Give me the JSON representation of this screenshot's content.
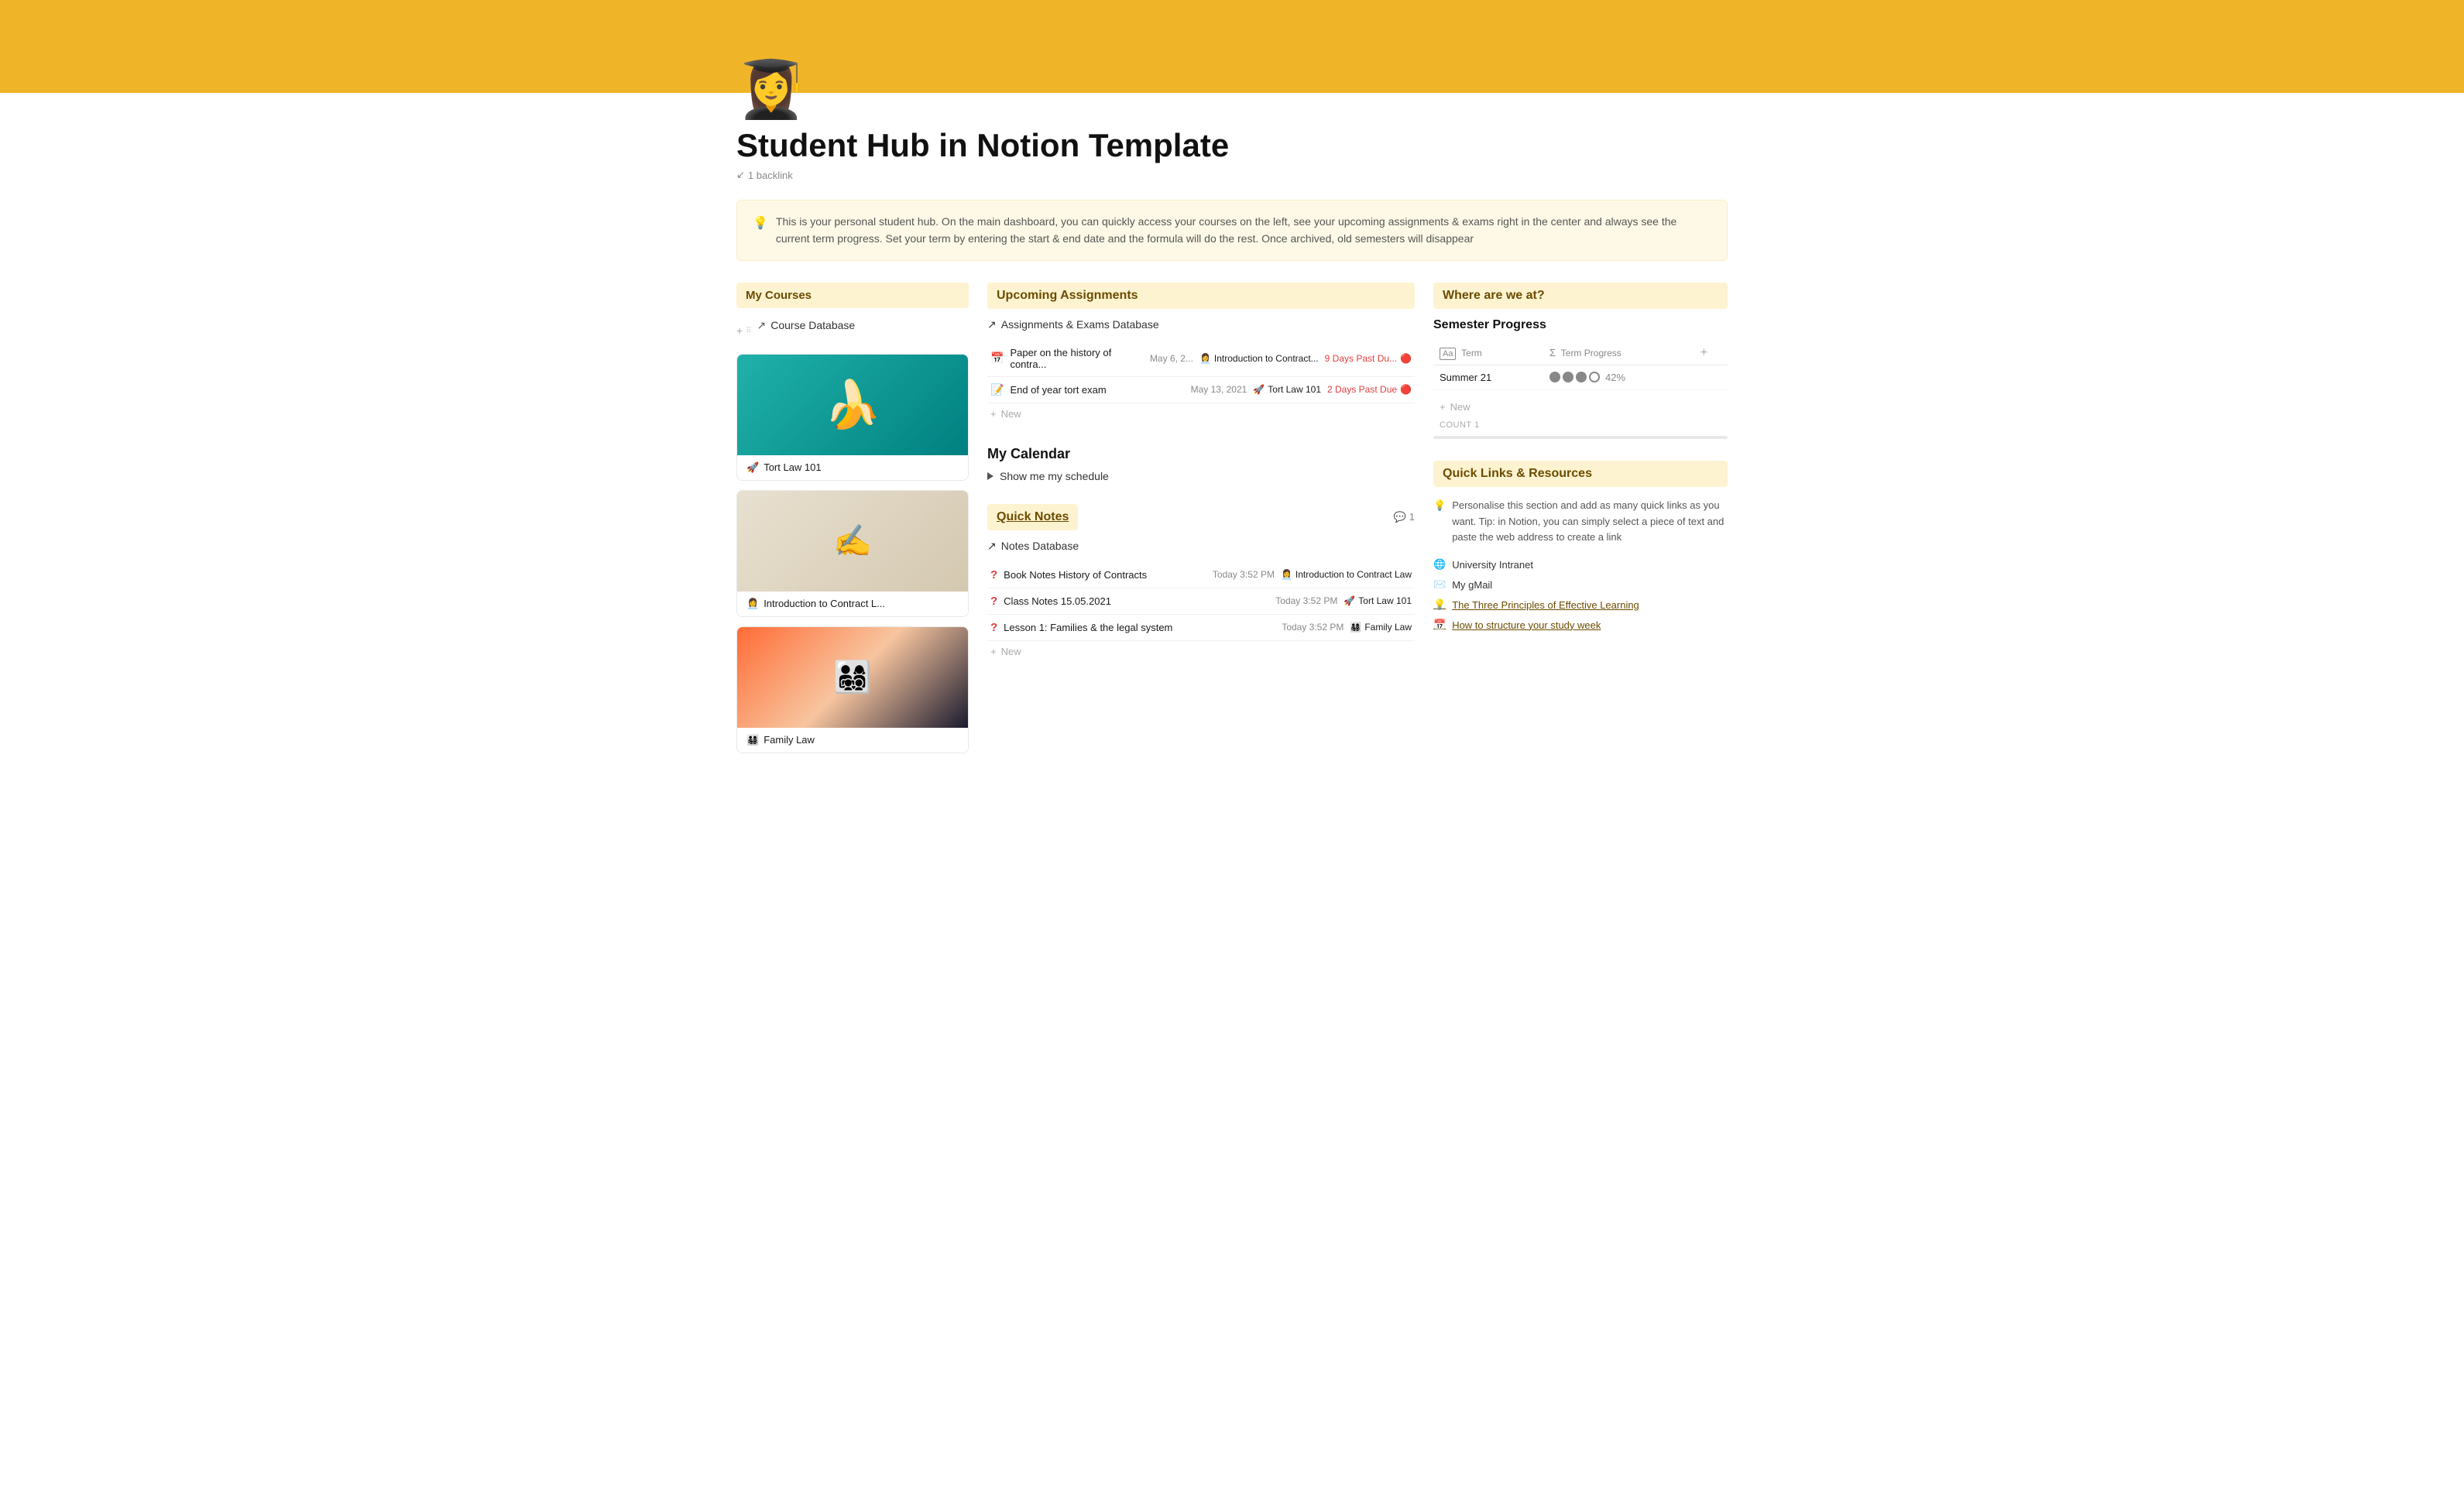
{
  "page": {
    "banner_color": "#f0b429",
    "icon": "👩‍🎓",
    "title": "Student Hub in Notion Template",
    "backlink_count": "1 backlink",
    "info_text": "This is your personal student hub. On the main dashboard, you can quickly access your courses on the left, see your upcoming assignments & exams right in the center and always see the current term progress. Set your term by entering the start & end date and the formula will do the rest. Once archived, old semesters will disappear"
  },
  "my_courses": {
    "title": "My Courses",
    "db_link": "Course Database",
    "courses": [
      {
        "emoji": "🚀",
        "label": "Tort Law 101",
        "bg": "teal"
      },
      {
        "emoji": "✍️",
        "label": "Introduction to Contract L...",
        "bg": "contract"
      },
      {
        "emoji": "👨‍👩‍👧‍👦",
        "label": "Family Law",
        "bg": "family"
      }
    ]
  },
  "upcoming_assignments": {
    "title": "Upcoming Assignments",
    "db_link": "Assignments & Exams Database",
    "assignments": [
      {
        "icon": "📅",
        "name": "Paper on the history of contra...",
        "date": "May 6, 2...",
        "course_emoji": "👩‍💼",
        "course": "Introduction to Contract...",
        "due": "9 Days Past Du...",
        "due_red": true
      },
      {
        "icon": "📝",
        "name": "End of year tort exam",
        "date": "May 13, 2021",
        "course_emoji": "🚀",
        "course": "Tort Law 101",
        "due": "2 Days Past Due",
        "due_red": true
      }
    ],
    "new_label": "New"
  },
  "calendar": {
    "title": "My Calendar",
    "toggle_label": "Show me my schedule"
  },
  "quick_notes": {
    "title": "Quick Notes",
    "comment_count": "1",
    "db_link": "Notes Database",
    "notes": [
      {
        "icon": "?",
        "name": "Book Notes History of Contracts",
        "time": "Today 3:52 PM",
        "course_emoji": "👩‍💼",
        "course": "Introduction to Contract Law"
      },
      {
        "icon": "?",
        "name": "Class Notes 15.05.2021",
        "time": "Today 3:52 PM",
        "course_emoji": "🚀",
        "course": "Tort Law 101"
      },
      {
        "icon": "?",
        "name": "Lesson 1: Families & the legal system",
        "time": "Today 3:52 PM",
        "course_emoji": "👨‍👩‍👧‍👦",
        "course": "Family Law"
      }
    ],
    "new_label": "New"
  },
  "semester_progress": {
    "where_title": "Where are we at?",
    "title": "Semester Progress",
    "col_term": "Term",
    "col_progress": "Term Progress",
    "rows": [
      {
        "term": "Summer 21",
        "progress_pct": "42%",
        "filled_circles": 3,
        "total_circles": 4
      }
    ],
    "count_label": "COUNT",
    "count_value": "1",
    "new_label": "New"
  },
  "quick_links": {
    "title": "Quick Links & Resources",
    "tip": "Personalise this section and add as many quick links as you want. Tip: in Notion, you can simply select a piece of text and paste the web address to create a link",
    "links": [
      {
        "icon": "🌐",
        "label": "University Intranet",
        "style": "normal"
      },
      {
        "icon": "✉️",
        "label": "My gMail",
        "style": "normal"
      },
      {
        "icon": "💡",
        "label": "The Three Principles of Effective Learning",
        "style": "underlined"
      },
      {
        "icon": "📅",
        "label": "How to structure your study week",
        "style": "underlined"
      }
    ]
  }
}
